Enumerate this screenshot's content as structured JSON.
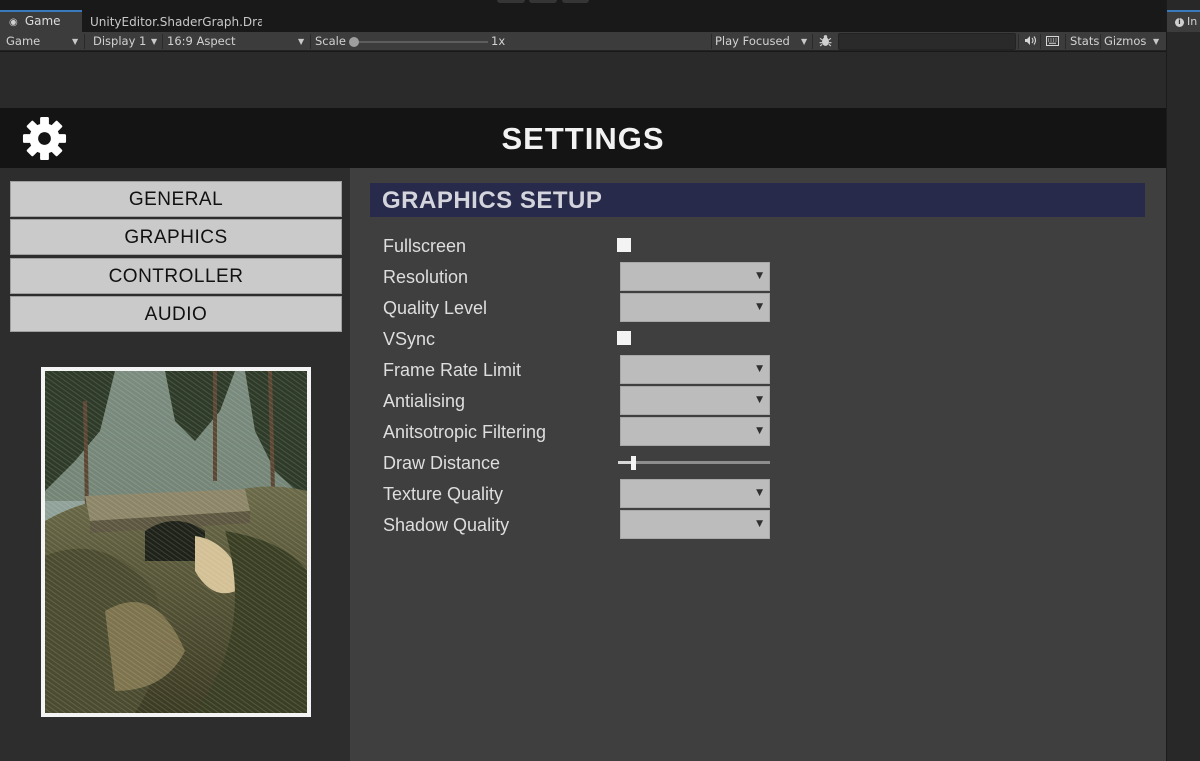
{
  "editor": {
    "tabs": {
      "game": "Game",
      "shader": "UnityEditor.ShaderGraph.Drawing",
      "inspector": "In"
    },
    "toolbar": {
      "view": "Game",
      "display": "Display 1",
      "aspect": "16:9 Aspect",
      "scale_label": "Scale",
      "scale_value": "1x",
      "play_mode": "Play Focused",
      "stats": "Stats",
      "gizmos": "Gizmos"
    },
    "icons": [
      "gamepad-icon",
      "bug-icon",
      "audio-icon",
      "keyboard-icon",
      "info-icon"
    ]
  },
  "settings": {
    "title": "SETTINGS",
    "nav": [
      "GENERAL",
      "GRAPHICS",
      "CONTROLLER",
      "AUDIO"
    ],
    "section_title": "GRAPHICS SETUP",
    "rows": [
      {
        "label": "Fullscreen",
        "control": "checkbox",
        "checked": false
      },
      {
        "label": "Resolution",
        "control": "dropdown",
        "value": ""
      },
      {
        "label": "Quality Level",
        "control": "dropdown",
        "value": ""
      },
      {
        "label": "VSync",
        "control": "checkbox",
        "checked": false
      },
      {
        "label": "Frame Rate Limit",
        "control": "dropdown",
        "value": ""
      },
      {
        "label": "Antialising",
        "control": "dropdown",
        "value": ""
      },
      {
        "label": "Anitsotropic Filtering",
        "control": "dropdown",
        "value": ""
      },
      {
        "label": "Draw Distance",
        "control": "slider",
        "level": 0.1
      },
      {
        "label": "Texture Quality",
        "control": "dropdown",
        "value": ""
      },
      {
        "label": "Shadow Quality",
        "control": "dropdown",
        "value": ""
      }
    ]
  },
  "colors": {
    "header_bg": "#141414",
    "section_bar": "#272a4b",
    "nav_button": "#cacaca",
    "dropdown": "#bcbcbc",
    "unity_accent": "#3a79bb"
  }
}
